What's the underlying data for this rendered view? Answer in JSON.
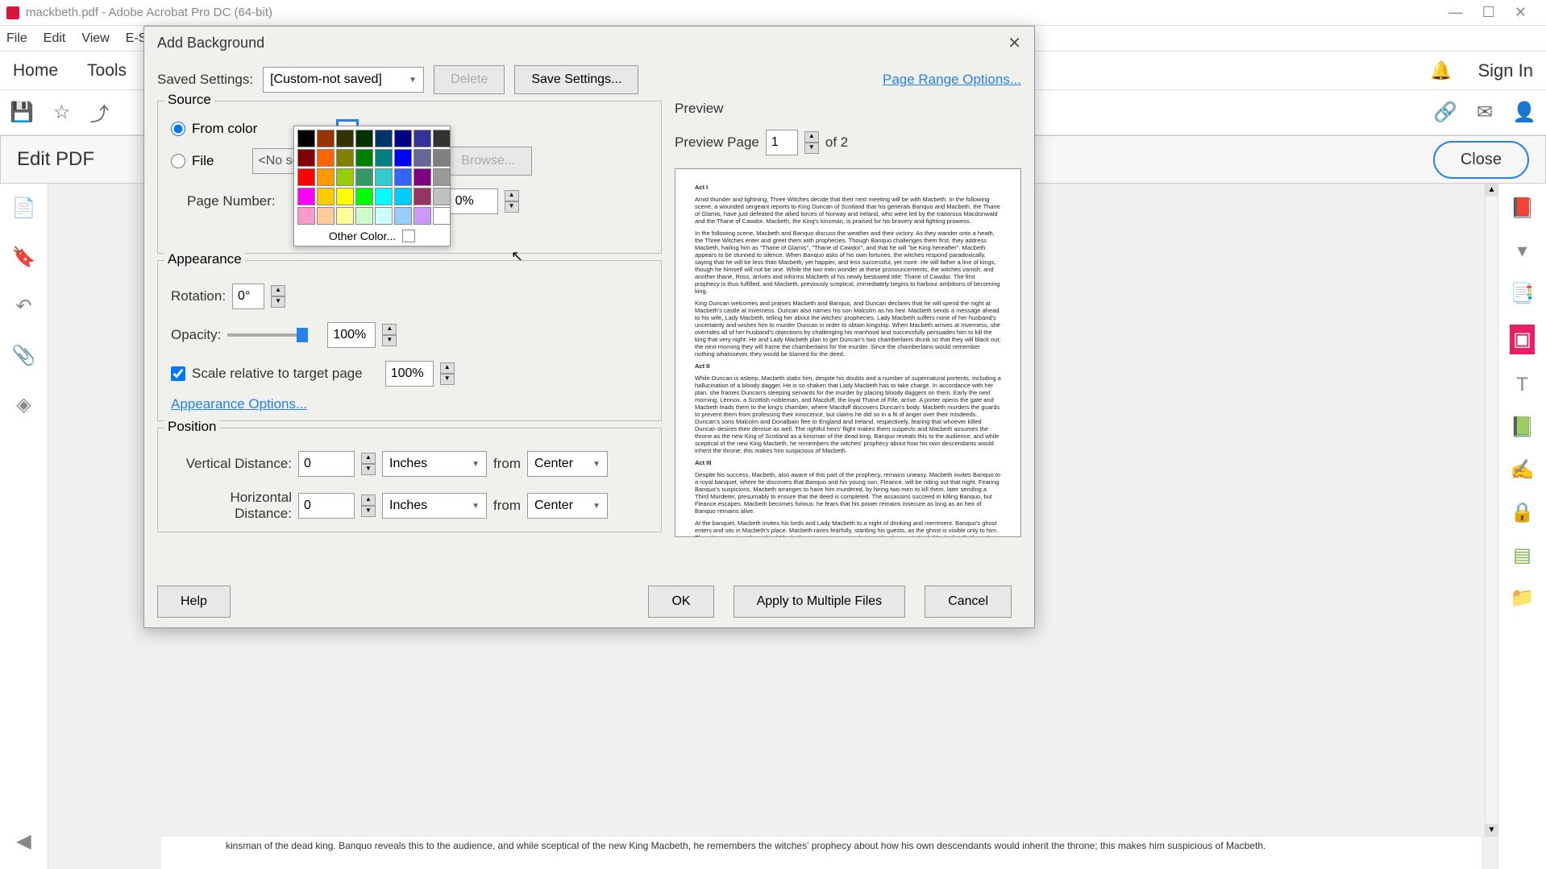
{
  "window": {
    "title": "mackbeth.pdf - Adobe Acrobat Pro DC (64-bit)"
  },
  "menu": {
    "file": "File",
    "edit": "Edit",
    "view": "View",
    "esign": "E-Si"
  },
  "nav": {
    "home": "Home",
    "tools": "Tools",
    "signin": "Sign In"
  },
  "editbar": {
    "label": "Edit PDF",
    "close": "Close"
  },
  "dialog": {
    "title": "Add Background",
    "saved_settings_label": "Saved Settings:",
    "saved_settings_value": "[Custom-not saved]",
    "delete": "Delete",
    "save_settings": "Save Settings...",
    "page_range_options": "Page Range Options...",
    "source": {
      "title": "Source",
      "from_color": "From color",
      "file": "File",
      "file_value": "<No so",
      "browse": "Browse...",
      "page_number_label": "Page Number:",
      "page_number_value": "0%"
    },
    "color_picker": {
      "other_color": "Other Color...",
      "colors": [
        [
          "#000000",
          "#993300",
          "#333300",
          "#003300",
          "#003366",
          "#000080",
          "#333399",
          "#333333"
        ],
        [
          "#800000",
          "#ff6600",
          "#808000",
          "#008000",
          "#008080",
          "#0000ff",
          "#666699",
          "#808080"
        ],
        [
          "#ff0000",
          "#ff9900",
          "#99cc00",
          "#339966",
          "#33cccc",
          "#3366ff",
          "#800080",
          "#999999"
        ],
        [
          "#ff00ff",
          "#ffcc00",
          "#ffff00",
          "#00ff00",
          "#00ffff",
          "#00ccff",
          "#993366",
          "#c0c0c0"
        ],
        [
          "#ff99cc",
          "#ffcc99",
          "#ffff99",
          "#ccffcc",
          "#ccffff",
          "#99ccff",
          "#cc99ff",
          "#ffffff"
        ]
      ]
    },
    "appearance": {
      "title": "Appearance",
      "rotation_label": "Rotation:",
      "rotation_value": "0°",
      "opacity_label": "Opacity:",
      "opacity_value": "100%",
      "scale_label": "Scale relative to target page",
      "scale_value": "100%",
      "options_link": "Appearance Options..."
    },
    "position": {
      "title": "Position",
      "vertical_label": "Vertical Distance:",
      "vertical_value": "0",
      "horizontal_label": "Horizontal Distance:",
      "horizontal_value": "0",
      "units": "Inches",
      "from": "from",
      "origin": "Center"
    },
    "preview": {
      "title": "Preview",
      "page_label": "Preview Page",
      "page_value": "1",
      "of_label": "of 2"
    },
    "buttons": {
      "help": "Help",
      "ok": "OK",
      "apply": "Apply to Multiple Files",
      "cancel": "Cancel"
    }
  },
  "doc_snippet": "kinsman of the dead king. Banquo reveals this to the audience, and while sceptical of the new King Macbeth, he remembers the witches' prophecy about how his own descendants would inherit the throne; this makes him suspicious of Macbeth.",
  "preview_text": {
    "act1_title": "Act I",
    "act1_p1": "Amid thunder and lightning, Three Witches decide that their next meeting will be with Macbeth. In the following scene, a wounded sergeant reports to King Duncan of Scotland that his generals Banquo and Macbeth, the Thane of Glamis, have just defeated the allied forces of Norway and Ireland, who were led by the traitorous Macdonwald and the Thane of Cawdor. Macbeth, the King's kinsman, is praised for his bravery and fighting prowess.",
    "act1_p2": "In the following scene, Macbeth and Banquo discuss the weather and their victory. As they wander onto a heath, the Three Witches enter and greet them with prophecies. Though Banquo challenges them first, they address Macbeth, hailing him as \"Thane of Glamis\", \"Thane of Cawdor\", and that he will \"be King hereafter\". Macbeth appears to be stunned to silence. When Banquo asks of his own fortunes, the witches respond paradoxically, saying that he will be less than Macbeth, yet happier, and less successful, yet more. He will father a line of kings, though he himself will not be one. While the two men wonder at these pronouncements, the witches vanish, and another thane, Ross, arrives and informs Macbeth of his newly bestowed title: Thane of Cawdor. The first prophecy is thus fulfilled, and Macbeth, previously sceptical, immediately begins to harbour ambitions of becoming king.",
    "act1_p3": "King Duncan welcomes and praises Macbeth and Banquo, and Duncan declares that he will spend the night at Macbeth's castle at Inverness. Duncan also names his son Malcolm as his heir. Macbeth sends a message ahead to his wife, Lady Macbeth, telling her about the witches' prophecies. Lady Macbeth suffers none of her husband's uncertainty and wishes him to murder Duncan in order to obtain kingship. When Macbeth arrives at Inverness, she overrides all of her husband's objections by challenging his manhood and successfully persuades him to kill the king that very night. He and Lady Macbeth plan to get Duncan's two chamberlains drunk so that they will black out; the next morning they will frame the chamberlains for the murder. Since the chamberlains would remember nothing whatsoever, they would be blamed for the deed.",
    "act2_title": "Act II",
    "act2_p1": "While Duncan is asleep, Macbeth stabs him, despite his doubts and a number of supernatural portents, including a hallucination of a bloody dagger. He is so shaken that Lady Macbeth has to take charge. In accordance with her plan, she frames Duncan's sleeping servants for the murder by placing bloody daggers on them. Early the next morning, Lennox, a Scottish nobleman, and Macduff, the loyal Thane of Fife, arrive. A porter opens the gate and Macbeth leads them to the king's chamber, where Macduff discovers Duncan's body. Macbeth murders the guards to prevent them from professing their innocence, but claims he did so in a fit of anger over their misdeeds. Duncan's sons Malcolm and Donalbain flee to England and Ireland, respectively, fearing that whoever killed Duncan desires their demise as well. The rightful heirs' flight makes them suspects and Macbeth assumes the throne as the new King of Scotland as a kinsman of the dead king. Banquo reveals this to the audience, and while sceptical of the new King Macbeth, he remembers the witches' prophecy about how his own descendants would inherit the throne; this makes him suspicious of Macbeth.",
    "act3_title": "Act III",
    "act3_p1": "Despite his success, Macbeth, also aware of this part of the prophecy, remains uneasy. Macbeth invites Banquo to a royal banquet, where he discovers that Banquo and his young son, Fleance, will be riding out that night. Fearing Banquo's suspicions, Macbeth arranges to have him murdered, by hiring two men to kill them, later sending a Third Murderer, presumably to ensure that the deed is completed. The assassins succeed in killing Banquo, but Fleance escapes. Macbeth becomes furious: he fears that his power remains insecure as long as an heir of Banquo remains alive.",
    "act3_p2": "At the banquet, Macbeth invites his lords and Lady Macbeth to a night of drinking and merriment. Banquo's ghost enters and sits in Macbeth's place. Macbeth raves fearfully, startling his guests, as the ghost is visible only to him. The others panic at the sight of Macbeth raging at an empty chair, until a desperate Lady Macbeth tells them that her husband is merely afflicted with a familiar and harmless malady. The ghost departs and returns once more, causing the same riotous anger and fear in Macbeth. This time, Lady Macbeth tells the visitors to leave, and they do so. At the end Hecate scolds the three weird sisters for helping Macbeth, especially without consulting her. Hecate instructs the Witches to give Macbeth false security. Note that some scholars believe the Hecate scene was added in later."
  }
}
